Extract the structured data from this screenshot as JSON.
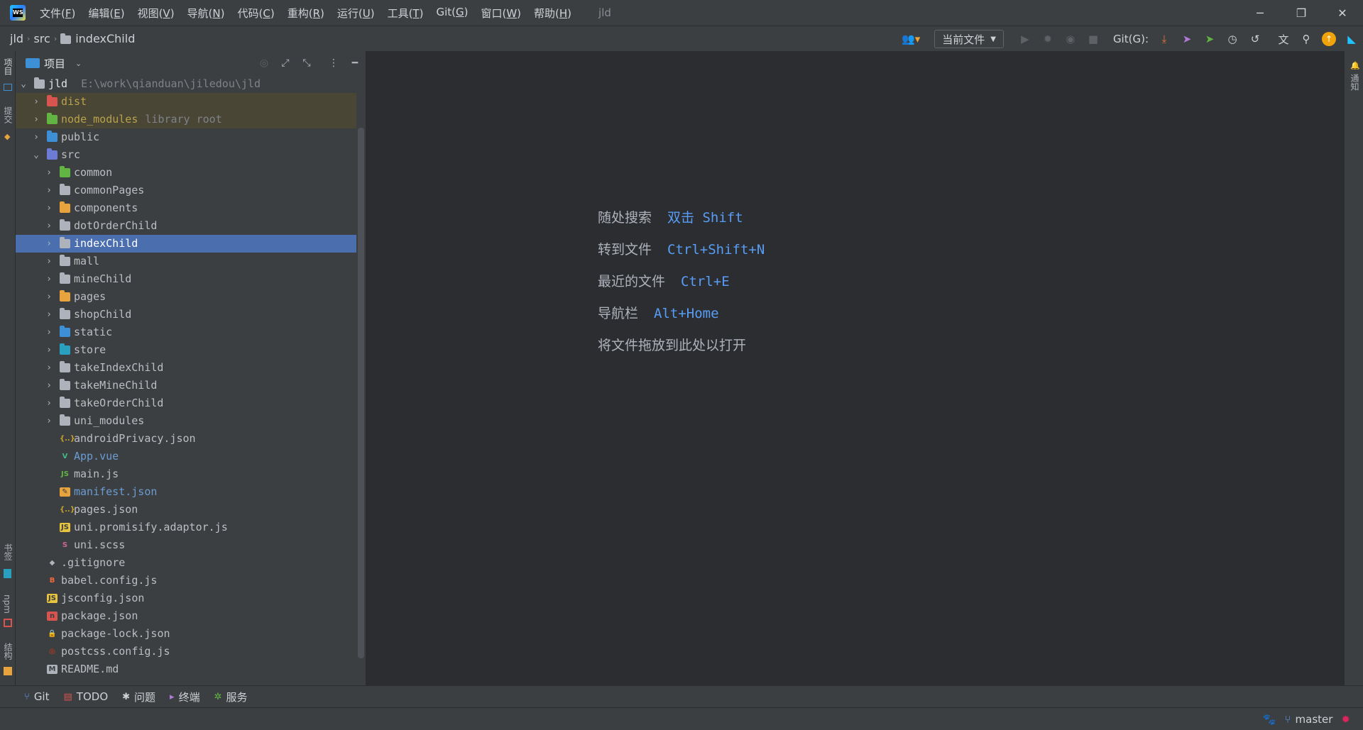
{
  "title_bar": {
    "menu": [
      {
        "label": "文件(",
        "acc": "F",
        "end": ")"
      },
      {
        "label": "编辑(",
        "acc": "E",
        "end": ")"
      },
      {
        "label": "视图(",
        "acc": "V",
        "end": ")"
      },
      {
        "label": "导航(",
        "acc": "N",
        "end": ")"
      },
      {
        "label": "代码(",
        "acc": "C",
        "end": ")"
      },
      {
        "label": "重构(",
        "acc": "R",
        "end": ")"
      },
      {
        "label": "运行(",
        "acc": "U",
        "end": ")"
      },
      {
        "label": "工具(",
        "acc": "T",
        "end": ")"
      },
      {
        "label": "Git(",
        "acc": "G",
        "end": ")"
      },
      {
        "label": "窗口(",
        "acc": "W",
        "end": ")"
      },
      {
        "label": "帮助(",
        "acc": "H",
        "end": ")"
      }
    ],
    "window_title": "jld",
    "controls": {
      "minimize": "─",
      "restore": "❐",
      "close": "✕"
    }
  },
  "breadcrumb": [
    "jld",
    "src",
    "indexChild"
  ],
  "toolbar": {
    "run_config": "当前文件",
    "git_label": "Git(G):"
  },
  "left_strip": {
    "project": "项目",
    "commit": "提交",
    "bookmarks": "书签",
    "npm": "npm",
    "structure": "结构"
  },
  "right_strip": {
    "notifications": "通知"
  },
  "project_panel": {
    "title": "项目",
    "root": {
      "name": "jld",
      "path": "E:\\work\\qianduan\\jiledou\\jld"
    },
    "tree": [
      {
        "name": "dist",
        "hint": "",
        "depth": 1,
        "arrow": "›",
        "icon": "folder red",
        "class": "excluded",
        "nameclass": "c-yellow-name"
      },
      {
        "name": "node_modules",
        "hint": "library root",
        "depth": 1,
        "arrow": "›",
        "icon": "folder green",
        "class": "excluded",
        "nameclass": "c-yellow-name"
      },
      {
        "name": "public",
        "hint": "",
        "depth": 1,
        "arrow": "›",
        "icon": "folder blue",
        "class": "",
        "nameclass": ""
      },
      {
        "name": "src",
        "hint": "",
        "depth": 1,
        "arrow": "⌄",
        "icon": "folder purple",
        "class": "",
        "nameclass": ""
      },
      {
        "name": "common",
        "hint": "",
        "depth": 2,
        "arrow": "›",
        "icon": "folder green",
        "class": "",
        "nameclass": ""
      },
      {
        "name": "commonPages",
        "hint": "",
        "depth": 2,
        "arrow": "›",
        "icon": "folder",
        "class": "",
        "nameclass": ""
      },
      {
        "name": "components",
        "hint": "",
        "depth": 2,
        "arrow": "›",
        "icon": "folder yellow",
        "class": "",
        "nameclass": ""
      },
      {
        "name": "dotOrderChild",
        "hint": "",
        "depth": 2,
        "arrow": "›",
        "icon": "folder",
        "class": "",
        "nameclass": ""
      },
      {
        "name": "indexChild",
        "hint": "",
        "depth": 2,
        "arrow": "›",
        "icon": "folder",
        "class": "selected",
        "nameclass": ""
      },
      {
        "name": "mall",
        "hint": "",
        "depth": 2,
        "arrow": "›",
        "icon": "folder",
        "class": "",
        "nameclass": ""
      },
      {
        "name": "mineChild",
        "hint": "",
        "depth": 2,
        "arrow": "›",
        "icon": "folder",
        "class": "",
        "nameclass": ""
      },
      {
        "name": "pages",
        "hint": "",
        "depth": 2,
        "arrow": "›",
        "icon": "folder yellow",
        "class": "",
        "nameclass": ""
      },
      {
        "name": "shopChild",
        "hint": "",
        "depth": 2,
        "arrow": "›",
        "icon": "folder",
        "class": "",
        "nameclass": ""
      },
      {
        "name": "static",
        "hint": "",
        "depth": 2,
        "arrow": "›",
        "icon": "folder blue",
        "class": "",
        "nameclass": ""
      },
      {
        "name": "store",
        "hint": "",
        "depth": 2,
        "arrow": "›",
        "icon": "folder teal",
        "class": "",
        "nameclass": ""
      },
      {
        "name": "takeIndexChild",
        "hint": "",
        "depth": 2,
        "arrow": "›",
        "icon": "folder",
        "class": "",
        "nameclass": ""
      },
      {
        "name": "takeMineChild",
        "hint": "",
        "depth": 2,
        "arrow": "›",
        "icon": "folder",
        "class": "",
        "nameclass": ""
      },
      {
        "name": "takeOrderChild",
        "hint": "",
        "depth": 2,
        "arrow": "›",
        "icon": "folder",
        "class": "",
        "nameclass": ""
      },
      {
        "name": "uni_modules",
        "hint": "",
        "depth": 2,
        "arrow": "›",
        "icon": "folder",
        "class": "",
        "nameclass": ""
      },
      {
        "name": "androidPrivacy.json",
        "hint": "",
        "depth": 2,
        "arrow": "",
        "icon": "json",
        "class": "",
        "nameclass": ""
      },
      {
        "name": "App.vue",
        "hint": "",
        "depth": 2,
        "arrow": "",
        "icon": "vue",
        "class": "",
        "nameclass": "c-blue"
      },
      {
        "name": "main.js",
        "hint": "",
        "depth": 2,
        "arrow": "",
        "icon": "nodejs",
        "class": "",
        "nameclass": ""
      },
      {
        "name": "manifest.json",
        "hint": "",
        "depth": 2,
        "arrow": "",
        "icon": "manifest",
        "class": "",
        "nameclass": "c-blue"
      },
      {
        "name": "pages.json",
        "hint": "",
        "depth": 2,
        "arrow": "",
        "icon": "json",
        "class": "",
        "nameclass": ""
      },
      {
        "name": "uni.promisify.adaptor.js",
        "hint": "",
        "depth": 2,
        "arrow": "",
        "icon": "js",
        "class": "",
        "nameclass": ""
      },
      {
        "name": "uni.scss",
        "hint": "",
        "depth": 2,
        "arrow": "",
        "icon": "scss",
        "class": "",
        "nameclass": ""
      },
      {
        "name": ".gitignore",
        "hint": "",
        "depth": 1,
        "arrow": "",
        "icon": "git",
        "class": "",
        "nameclass": ""
      },
      {
        "name": "babel.config.js",
        "hint": "",
        "depth": 1,
        "arrow": "",
        "icon": "babel",
        "class": "",
        "nameclass": ""
      },
      {
        "name": "jsconfig.json",
        "hint": "",
        "depth": 1,
        "arrow": "",
        "icon": "jsconfig",
        "class": "",
        "nameclass": ""
      },
      {
        "name": "package.json",
        "hint": "",
        "depth": 1,
        "arrow": "",
        "icon": "npm",
        "class": "",
        "nameclass": ""
      },
      {
        "name": "package-lock.json",
        "hint": "",
        "depth": 1,
        "arrow": "",
        "icon": "lock",
        "class": "",
        "nameclass": ""
      },
      {
        "name": "postcss.config.js",
        "hint": "",
        "depth": 1,
        "arrow": "",
        "icon": "postcss",
        "class": "",
        "nameclass": ""
      },
      {
        "name": "README.md",
        "hint": "",
        "depth": 1,
        "arrow": "",
        "icon": "md",
        "class": "",
        "nameclass": ""
      }
    ]
  },
  "editor_hints": [
    {
      "label": "随处搜索",
      "key": "双击 Shift"
    },
    {
      "label": "转到文件",
      "key": "Ctrl+Shift+N"
    },
    {
      "label": "最近的文件",
      "key": "Ctrl+E"
    },
    {
      "label": "导航栏",
      "key": "Alt+Home"
    },
    {
      "label": "将文件拖放到此处以打开",
      "key": ""
    }
  ],
  "bottom_tabs": [
    {
      "label": "Git",
      "icon": "git-branch-icon",
      "glyph": "⑂",
      "color": "#589df6"
    },
    {
      "label": "TODO",
      "icon": "todo-icon",
      "glyph": "▤",
      "color": "#d9534f"
    },
    {
      "label": "问题",
      "icon": "problems-icon",
      "glyph": "✱",
      "color": "#cfd1d6"
    },
    {
      "label": "终端",
      "icon": "terminal-icon",
      "glyph": "▸",
      "color": "#b07ad6"
    },
    {
      "label": "服务",
      "icon": "services-icon",
      "glyph": "✲",
      "color": "#62b543"
    }
  ],
  "status_bar": {
    "branch": "master"
  },
  "colors": {
    "selection": "#4b6eaf",
    "panel": "#3c3f41",
    "editor": "#2b2d30",
    "link": "#589df6"
  }
}
